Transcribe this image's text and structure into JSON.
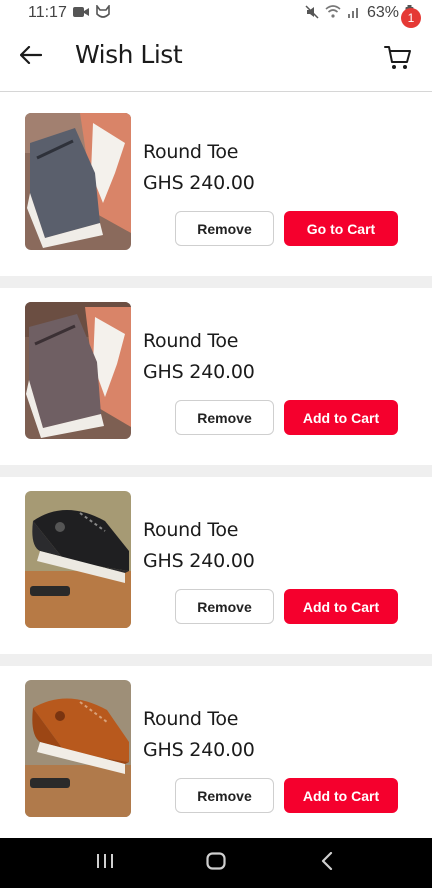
{
  "status_bar": {
    "time": "11:17",
    "battery": "63%",
    "icons": [
      "video-icon",
      "cat-icon",
      "mute-icon",
      "wifi-icon",
      "signal-icon",
      "battery-icon"
    ]
  },
  "header": {
    "title": "Wish List",
    "cart_count": "1"
  },
  "items": [
    {
      "name": "Round Toe",
      "price": "GHS 240.00",
      "remove_label": "Remove",
      "cart_label": "Go to Cart"
    },
    {
      "name": "Round Toe",
      "price": "GHS 240.00",
      "remove_label": "Remove",
      "cart_label": "Add to Cart"
    },
    {
      "name": "Round Toe",
      "price": "GHS 240.00",
      "remove_label": "Remove",
      "cart_label": "Add to Cart"
    },
    {
      "name": "Round Toe",
      "price": "GHS 240.00",
      "remove_label": "Remove",
      "cart_label": "Add to Cart"
    }
  ],
  "colors": {
    "accent": "#f5002d",
    "badge": "#e53935",
    "separator": "#efefef"
  },
  "nav": [
    "recent-apps-icon",
    "home-icon",
    "back-nav-icon"
  ]
}
